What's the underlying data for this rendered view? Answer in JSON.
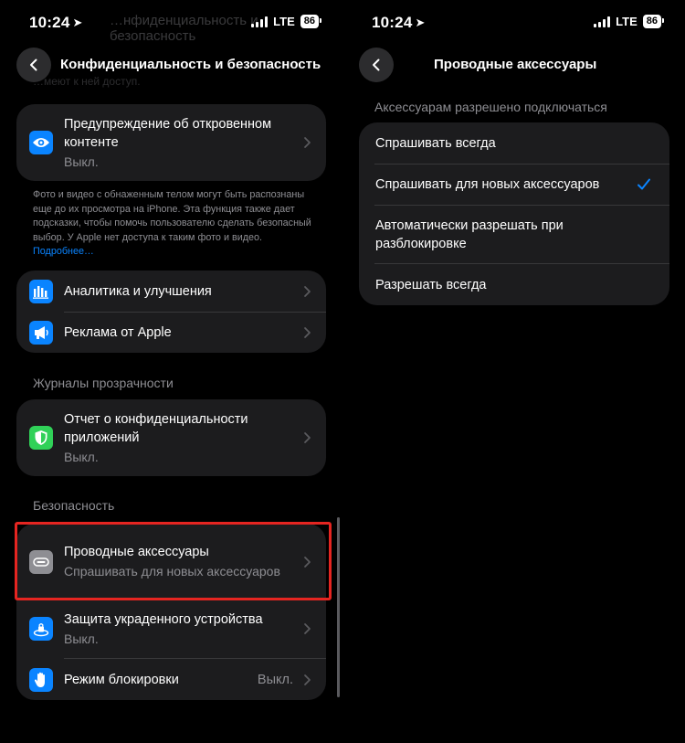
{
  "status": {
    "time": "10:24",
    "network": "LTE",
    "battery": "86"
  },
  "left": {
    "ghost_title": "…нфиденциальность и безопасность",
    "ghost_sub": "…меют к ней доступ.",
    "title": "Конфиденциальность и безопасность",
    "sensitive": {
      "title": "Предупреждение об откровенном контенте",
      "value": "Выкл."
    },
    "footnote": "Фото и видео с обнаженным телом могут быть распознаны еще до их просмотра на iPhone. Эта функция также дает подсказки, чтобы помочь пользователю сделать безопасный выбор. У Apple нет доступа к таким фото и видео.",
    "footnote_link": "Подробнее…",
    "analytics_label": "Аналитика и улучшения",
    "ads_label": "Реклама от Apple",
    "section_transparency": "Журналы прозрачности",
    "app_report": {
      "title": "Отчет о конфиденциальности приложений",
      "value": "Выкл."
    },
    "section_security": "Безопасность",
    "wired": {
      "title": "Проводные аксессуары",
      "value": "Спрашивать для новых аксессуаров"
    },
    "stolen": {
      "title": "Защита украденного устройства",
      "value": "Выкл."
    },
    "lockdown": {
      "title": "Режим блокировки",
      "value": "Выкл."
    }
  },
  "right": {
    "title": "Проводные аксессуары",
    "section_label": "Аксессуарам разрешено подключаться",
    "options": [
      {
        "label": "Спрашивать всегда",
        "selected": false
      },
      {
        "label": "Спрашивать для новых аксессуаров",
        "selected": true
      },
      {
        "label": "Автоматически разрешать при разблокировке",
        "selected": false
      },
      {
        "label": "Разрешать всегда",
        "selected": false
      }
    ]
  },
  "colors": {
    "accent": "#0a84ff",
    "highlight": "#e52521",
    "icon_blue": "#0a84ff",
    "icon_green": "#30d158",
    "icon_gray": "#8e8e93"
  },
  "icons": {
    "back": "chevron-left-icon",
    "sensitive": "eye-icon",
    "analytics": "bar-chart-icon",
    "ads": "megaphone-icon",
    "app_report": "shield-icon",
    "wired": "cable-connector-icon",
    "stolen": "device-protection-icon",
    "lockdown": "hand-icon",
    "checkmark": "checkmark-icon"
  }
}
